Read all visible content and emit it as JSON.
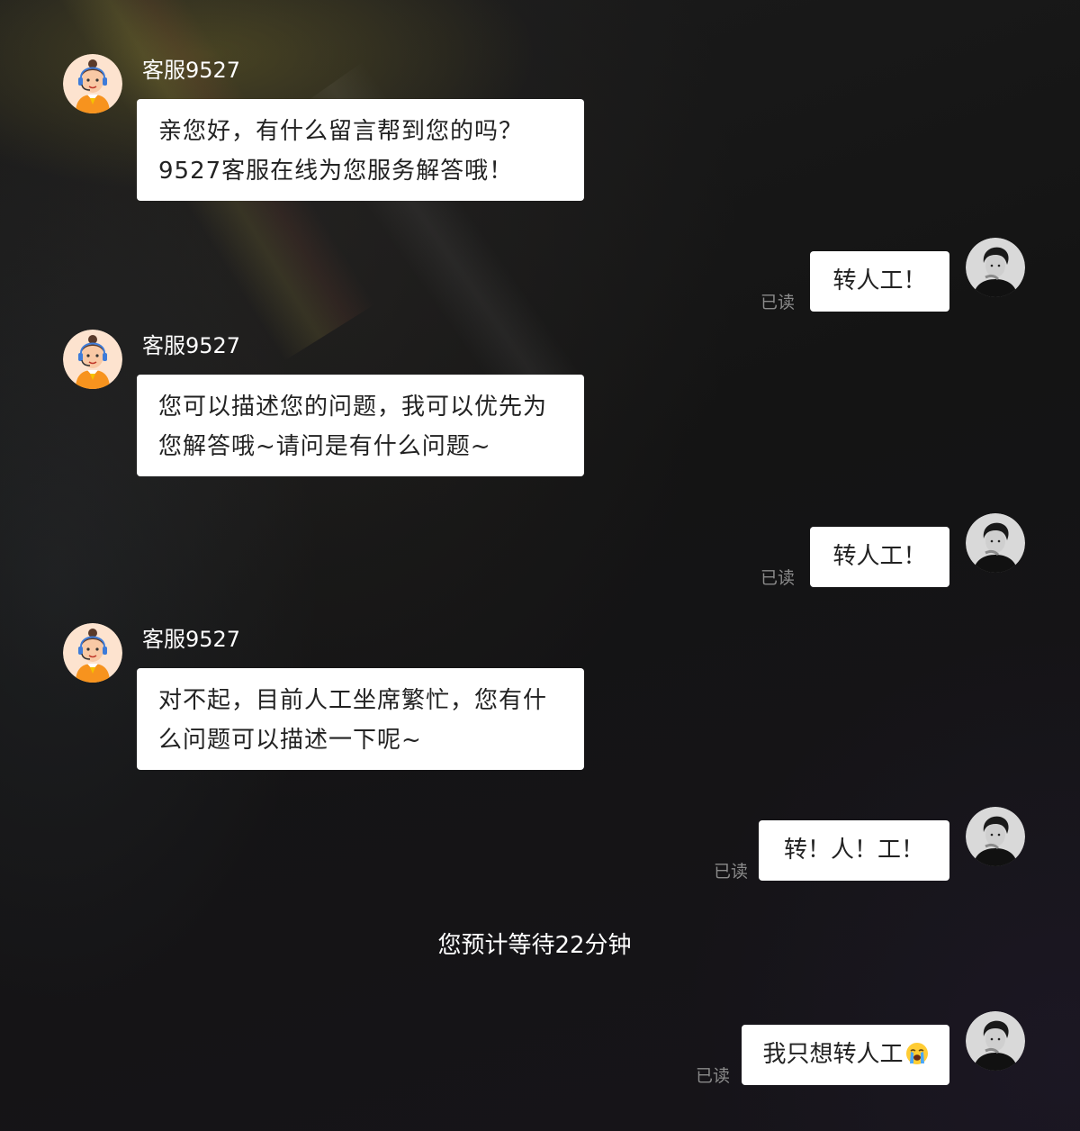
{
  "agent": {
    "name": "客服9527"
  },
  "messages": {
    "m1": {
      "line1": "亲您好，有什么留言帮到您的吗？",
      "line2": "9527客服在线为您服务解答哦！"
    },
    "m2": {
      "text": "转人工！",
      "status": "已读"
    },
    "m3": {
      "line1": "您可以描述您的问题，我可以优先为",
      "line2": "您解答哦~请问是有什么问题~"
    },
    "m4": {
      "text": "转人工！",
      "status": "已读"
    },
    "m5": {
      "line1": "对不起，目前人工坐席繁忙，您有什",
      "line2": "么问题可以描述一下呢~"
    },
    "m6": {
      "text": "转！人！工！",
      "status": "已读"
    },
    "m8": {
      "text": "我只想转人工",
      "emoji": "loudly-crying-face-icon",
      "status": "已读"
    }
  },
  "system_notice": "您预计等待22分钟",
  "colors": {
    "bubble": "#ffffff",
    "name": "#ffffff",
    "read_status": "#8a8a8a",
    "agent_avatar_bg": "#fde3cf",
    "agent_uniform": "#f7931e"
  }
}
